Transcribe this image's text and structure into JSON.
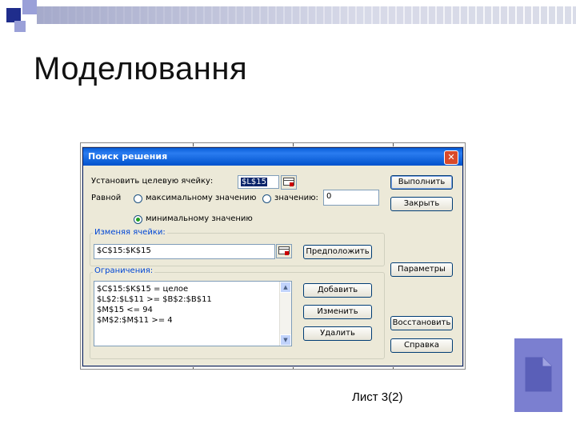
{
  "slide": {
    "title": "Моделювання",
    "caption": "Лист 3(2)"
  },
  "dialog": {
    "title": "Поиск решения",
    "target_label": "Установить целевую ячейку:",
    "target_value": "$L$15",
    "equal_label": "Равной",
    "radio_max": "максимальному значению",
    "radio_value": "значению:",
    "value_field": "0",
    "radio_min": "минимальному значению",
    "selected_radio": "min",
    "changing_cells_label": "Изменяя ячейки:",
    "changing_cells_value": "$C$15:$K$15",
    "constraints_label": "Ограничения:",
    "constraints": [
      "$C$15:$K$15 = целое",
      "$L$2:$L$11 >= $B$2:$B$11",
      "$M$15 <= 94",
      "$M$2:$M$11 >= 4"
    ],
    "buttons": {
      "solve": "Выполнить",
      "close": "Закрыть",
      "guess": "Предположить",
      "options": "Параметры",
      "add": "Добавить",
      "change": "Изменить",
      "delete": "Удалить",
      "reset": "Восстановить",
      "help": "Справка"
    }
  },
  "icons": {
    "close": "close-icon",
    "collapse": "collapse-dialog-icon",
    "document": "document-icon"
  },
  "colors": {
    "titlebar": "#0a5fd8",
    "accent_square": "#1f2d8c",
    "doc_box": "#7b7fd0"
  }
}
